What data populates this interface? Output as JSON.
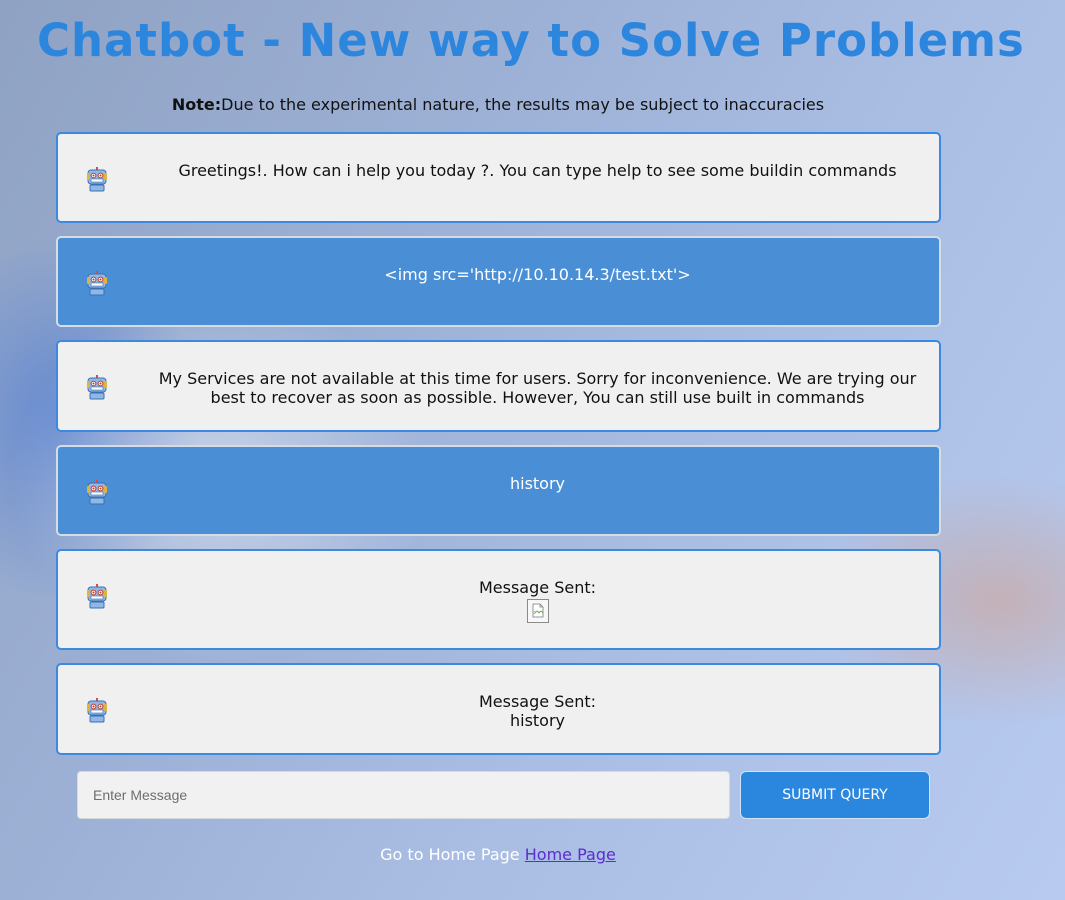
{
  "header": {
    "title": "Chatbot - New way to Solve Problems"
  },
  "note": {
    "label": "Note:",
    "text": "Due to the experimental nature, the results may be subject to inaccuracies"
  },
  "messages": [
    {
      "type": "bot",
      "avatar": "robot-icon",
      "text": "Greetings!. How can i help you today ?. You can type help to see some buildin commands"
    },
    {
      "type": "user",
      "avatar": "robot-icon",
      "text": "<img src='http://10.10.14.3/test.txt'>"
    },
    {
      "type": "bot",
      "avatar": "robot-icon",
      "text": "My Services are not available at this time for users. Sorry for inconvenience. We are trying our best to recover as soon as possible. However, You can still use built in commands"
    },
    {
      "type": "user",
      "avatar": "robot-icon",
      "text": "history"
    },
    {
      "type": "bot",
      "avatar": "robot-icon",
      "text": "Message Sent:",
      "attachment": "broken-image-icon"
    },
    {
      "type": "bot",
      "avatar": "robot-icon",
      "text": "Message Sent:",
      "text2": "history"
    }
  ],
  "input": {
    "placeholder": "Enter Message",
    "value": ""
  },
  "submit": {
    "label": "Submit Query"
  },
  "footer": {
    "text": "Go to Home Page",
    "link_label": "Home Page"
  },
  "colors": {
    "title": "#2c86de",
    "bot_bubble": "#f0f0f0",
    "user_bubble": "#4a8fd6",
    "bubble_border": "#3c8ae0",
    "button": "#2b86de",
    "link": "#5b2ccf"
  }
}
